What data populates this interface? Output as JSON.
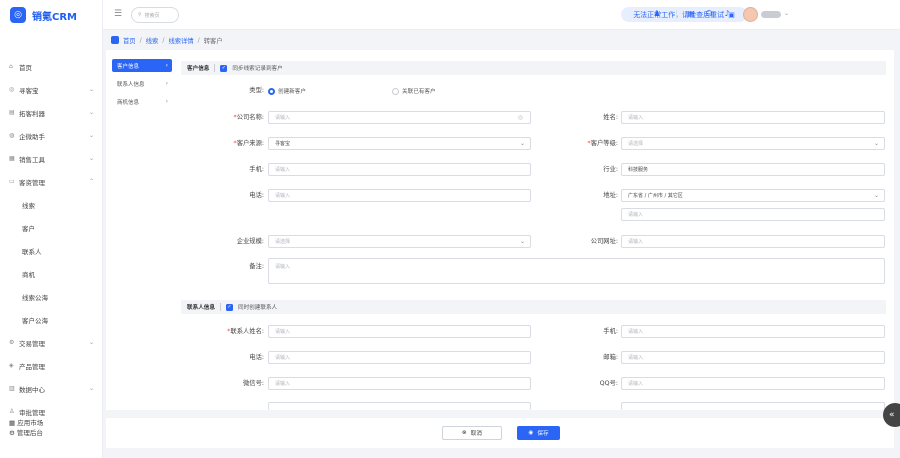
{
  "app": {
    "name": "销氪CRM"
  },
  "colors": {
    "accent": "#2a65f5",
    "required": "#f04646"
  },
  "topbar": {
    "search_placeholder": "搜索页",
    "notice": "无法正常工作，请检查后重试"
  },
  "sidebar": {
    "items": [
      {
        "label": "首页",
        "icon": "home-icon"
      },
      {
        "label": "寻客宝",
        "icon": "target-icon"
      },
      {
        "label": "拓客利器",
        "icon": "tool-icon"
      },
      {
        "label": "企微助手",
        "icon": "wechat-icon"
      },
      {
        "label": "销售工具",
        "icon": "grid-icon"
      },
      {
        "label": "客资管理",
        "icon": "customer-icon"
      },
      {
        "label": "线索"
      },
      {
        "label": "客户"
      },
      {
        "label": "联系人"
      },
      {
        "label": "商机"
      },
      {
        "label": "线索公海"
      },
      {
        "label": "客户公海"
      },
      {
        "label": "交易管理",
        "icon": "deal-icon"
      },
      {
        "label": "产品管理",
        "icon": "box-icon"
      },
      {
        "label": "数据中心",
        "icon": "chart-icon"
      },
      {
        "label": "审批管理",
        "icon": "approve-icon"
      }
    ],
    "bottom": [
      "应用市场",
      "管理后台"
    ]
  },
  "breadcrumb": [
    "首页",
    "线索",
    "线索详情",
    "转客户"
  ],
  "left_nav": [
    "客户信息",
    "联系人信息",
    "商机信息"
  ],
  "customer_section": {
    "title": "客户信息",
    "sync_label": "同步线索记录到客户",
    "type_label": "类型:",
    "type_options": [
      "创建新客户",
      "关联已有客户"
    ],
    "fields": {
      "company": {
        "label": "公司名称:",
        "placeholder": "请输入"
      },
      "name": {
        "label": "姓名:",
        "placeholder": "请输入"
      },
      "source": {
        "label": "客户来源:",
        "value": "寻客宝"
      },
      "level": {
        "label": "客户等级:",
        "placeholder": "请选择"
      },
      "phone": {
        "label": "手机:",
        "placeholder": "请输入"
      },
      "industry": {
        "label": "行业:",
        "value": "科技服务"
      },
      "tel": {
        "label": "电话:",
        "placeholder": "请输入"
      },
      "address": {
        "label": "地址:",
        "value": "广东省 / 广州市 / 其它区",
        "detail_placeholder": "请输入"
      },
      "scale": {
        "label": "企业规模:",
        "placeholder": "请选择"
      },
      "website": {
        "label": "公司网址:",
        "placeholder": "请输入"
      },
      "remark": {
        "label": "备注:",
        "placeholder": "请输入"
      }
    }
  },
  "contact_section": {
    "title": "联系人信息",
    "sync_label": "同时创建联系人",
    "fields": {
      "contact_name": {
        "label": "联系人姓名:",
        "placeholder": "请输入"
      },
      "mobile": {
        "label": "手机:",
        "placeholder": "请输入"
      },
      "tel": {
        "label": "电话:",
        "placeholder": "请输入"
      },
      "email": {
        "label": "邮箱:",
        "placeholder": "请输入"
      },
      "wechat": {
        "label": "微信号:",
        "placeholder": "请输入"
      },
      "qq": {
        "label": "QQ号:",
        "placeholder": "请输入"
      }
    }
  },
  "footer": {
    "cancel": "取消",
    "save": "保存"
  }
}
